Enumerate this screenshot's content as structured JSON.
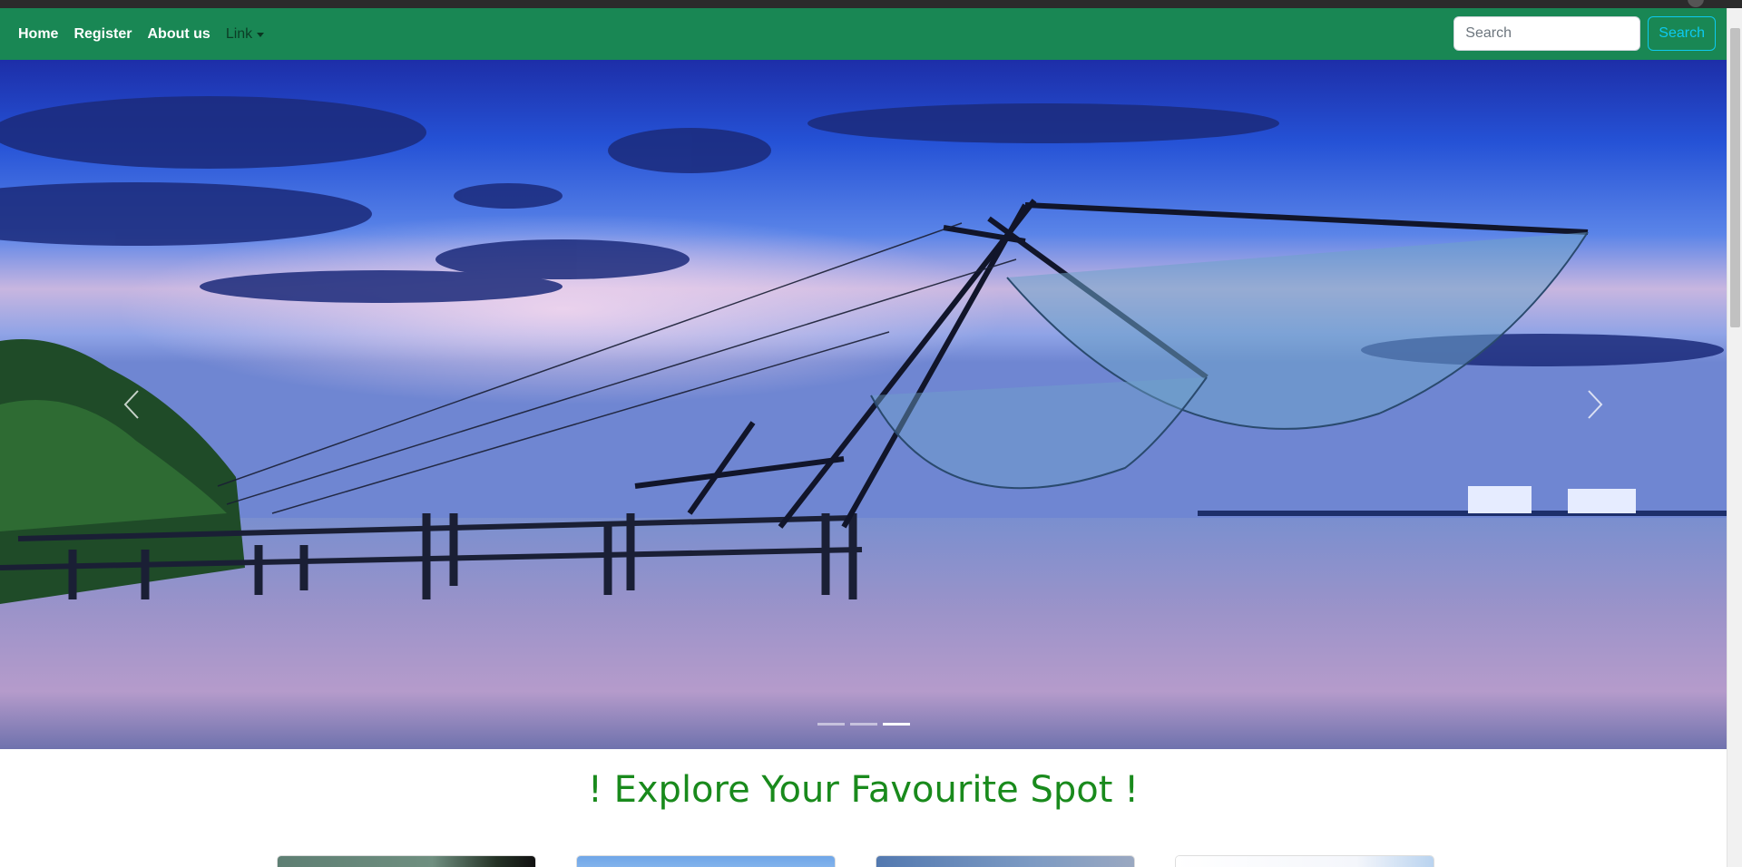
{
  "navbar": {
    "links": [
      "Home",
      "Register",
      "About us"
    ],
    "dropdown_label": "Link",
    "search_placeholder": "Search",
    "search_button": "Search",
    "colors": {
      "background": "#198754",
      "search_button": "#0dcaf0"
    }
  },
  "carousel": {
    "slide_count": 3,
    "active_index": 2,
    "prev_icon": "chevron-left-icon",
    "next_icon": "chevron-right-icon"
  },
  "main": {
    "heading": "! Explore Your Favourite Spot !",
    "heading_color": "#198a1c",
    "card_count": 4
  }
}
